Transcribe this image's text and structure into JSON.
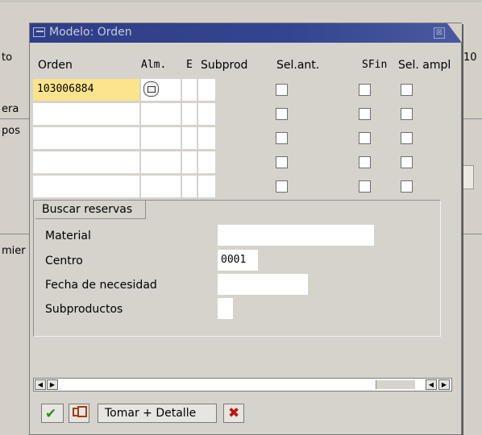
{
  "background": {
    "label_to": "to",
    "label_10": "10",
    "label_era": "era",
    "label_pos": "pos",
    "label_mier": "mier"
  },
  "dialog": {
    "title": "Modelo: Orden",
    "close_glyph": "⊠"
  },
  "table": {
    "headers": {
      "orden": "Orden",
      "alm": "Alm.",
      "e": "E",
      "subprod": "Subprod",
      "sel_ant": "Sel.ant.",
      "sfin": "SFin",
      "sel_ampl": "Sel. ampl"
    },
    "rows": [
      {
        "orden": "103006884",
        "sel_ant": false,
        "sfin": false,
        "sel_ampl": false
      },
      {
        "orden": "",
        "sel_ant": false,
        "sfin": false,
        "sel_ampl": false
      },
      {
        "orden": "",
        "sel_ant": false,
        "sfin": false,
        "sel_ampl": false
      },
      {
        "orden": "",
        "sel_ant": false,
        "sfin": false,
        "sel_ampl": false
      },
      {
        "orden": "",
        "sel_ant": false,
        "sfin": false,
        "sel_ampl": false
      }
    ]
  },
  "search": {
    "group_title": "Buscar reservas",
    "material_label": "Material",
    "material_value": "",
    "centro_label": "Centro",
    "centro_value": "0001",
    "fecha_label": "Fecha de necesidad",
    "fecha_value": "",
    "subproductos_label": "Subproductos",
    "subproductos_value": ""
  },
  "footer": {
    "tomar_label": "Tomar + Detalle"
  },
  "icons": {
    "confirm": "check-icon",
    "copy": "copy-icon",
    "cancel": "cancel-icon",
    "lookup": "lookup-icon"
  },
  "colors": {
    "title_bar": "#2f3e86",
    "active_cell": "#fce48c",
    "confirm": "#2d8a22",
    "cancel": "#c01212"
  }
}
